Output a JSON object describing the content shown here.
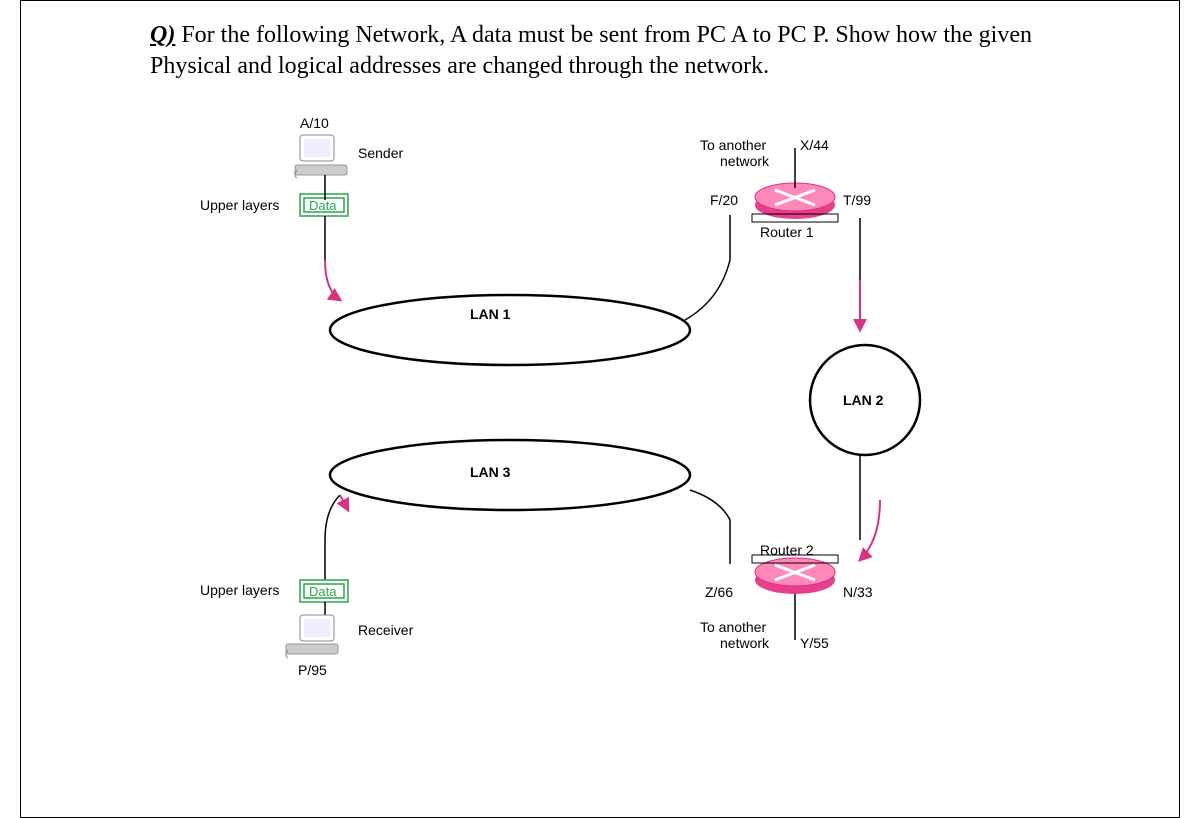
{
  "question": {
    "label": "Q)",
    "text": "For the following Network, A data must be sent from PC A to PC P. Show how the given Physical and logical addresses are changed through the network."
  },
  "nodes": {
    "sender": {
      "addr": "A/10",
      "role": "Sender",
      "layers": "Upper layers",
      "data": "Data"
    },
    "receiver": {
      "addr": "P/95",
      "role": "Receiver",
      "layers": "Upper layers",
      "data": "Data"
    },
    "router1": {
      "name": "Router 1",
      "left_if": "F/20",
      "right_if": "T/99",
      "ext_if": "X/44",
      "ext_label": "To another\nnetwork"
    },
    "router2": {
      "name": "Router 2",
      "left_if": "Z/66",
      "right_if": "N/33",
      "ext_if": "Y/55",
      "ext_label": "To another\nnetwork"
    }
  },
  "lans": {
    "lan1": "LAN 1",
    "lan2": "LAN 2",
    "lan3": "LAN 3"
  }
}
